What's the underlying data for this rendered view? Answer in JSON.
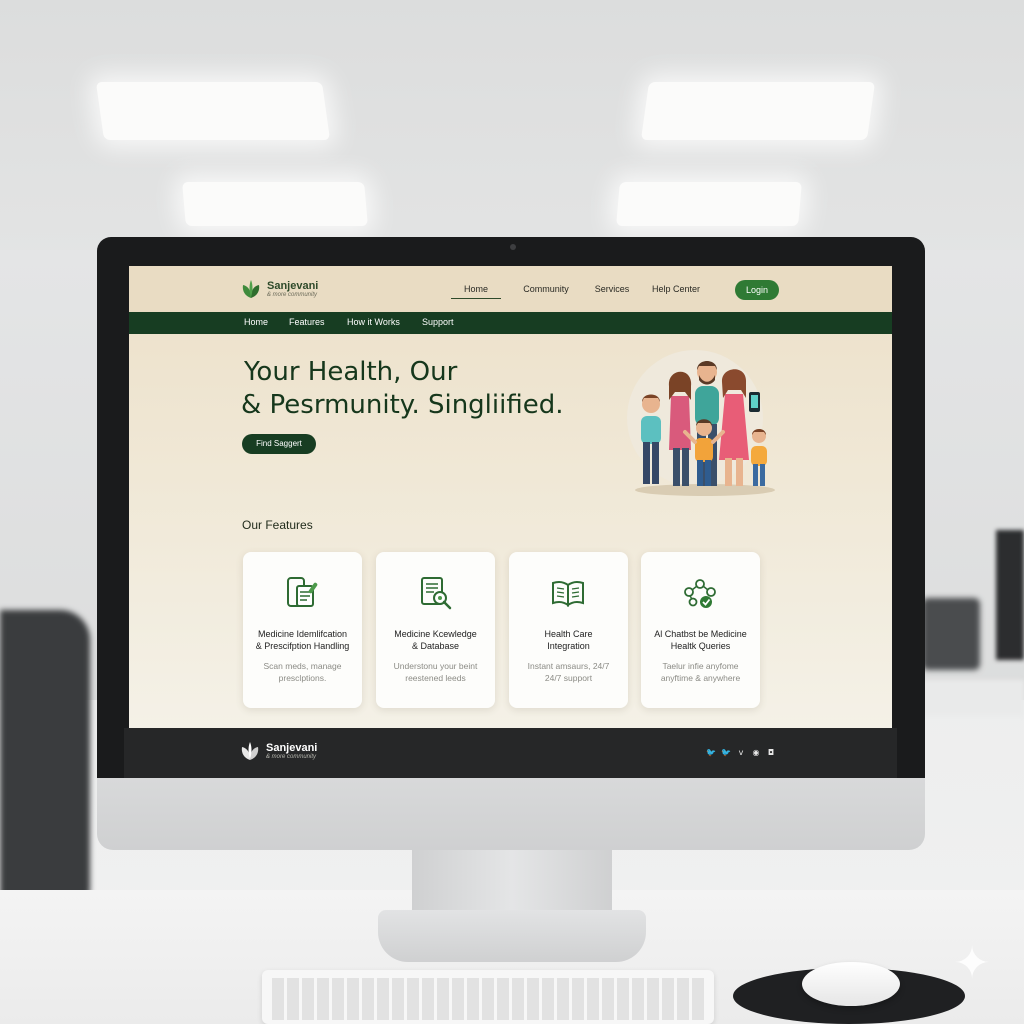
{
  "brand": {
    "name": "Sanjevani",
    "tagline": "& more community",
    "color_primary": "#173d22",
    "color_accent": "#2f7a34",
    "color_background": "#ece0c9"
  },
  "topnav": {
    "items": [
      "Home",
      "Community",
      "Services",
      "Help Center"
    ],
    "active": "Home",
    "login_label": "Login"
  },
  "subnav": {
    "items": [
      "Home",
      "Features",
      "How it Works",
      "Support"
    ]
  },
  "hero": {
    "title_line1": "Your Health, Our",
    "title_line2": "& Pesrmunity. Singliified.",
    "cta_label": "Find Saggert"
  },
  "features": {
    "heading": "Our Features",
    "cards": [
      {
        "icon": "phone-prescription-icon",
        "title_line1": "Medicine Idemlifcation",
        "title_line2": "& Prescifption Handling",
        "desc_line1": "Scan meds, manage",
        "desc_line2": "presclptions."
      },
      {
        "icon": "document-search-icon",
        "title_line1": "Medicine Kcewledge",
        "title_line2": "& Database",
        "desc_line1": "Understonu your beint",
        "desc_line2": "reestened leeds"
      },
      {
        "icon": "open-book-icon",
        "title_line1": "Health Care",
        "title_line2": "Integration",
        "desc_line1": "Instant amsaurs, 24/7",
        "desc_line2": "24/7 support"
      },
      {
        "icon": "chatbot-network-icon",
        "title_line1": "Al Chatbst be Medicine",
        "title_line2": "Healtk Queries",
        "desc_line1": "Taelur infie anyfome",
        "desc_line2": "anyftime & anywhere"
      }
    ]
  },
  "footer": {
    "name": "Sanjevani",
    "tagline": "& more community",
    "social_icons": [
      "twitter-icon",
      "twitter-icon",
      "vimeo-icon",
      "pinterest-icon",
      "instagram-icon"
    ]
  }
}
